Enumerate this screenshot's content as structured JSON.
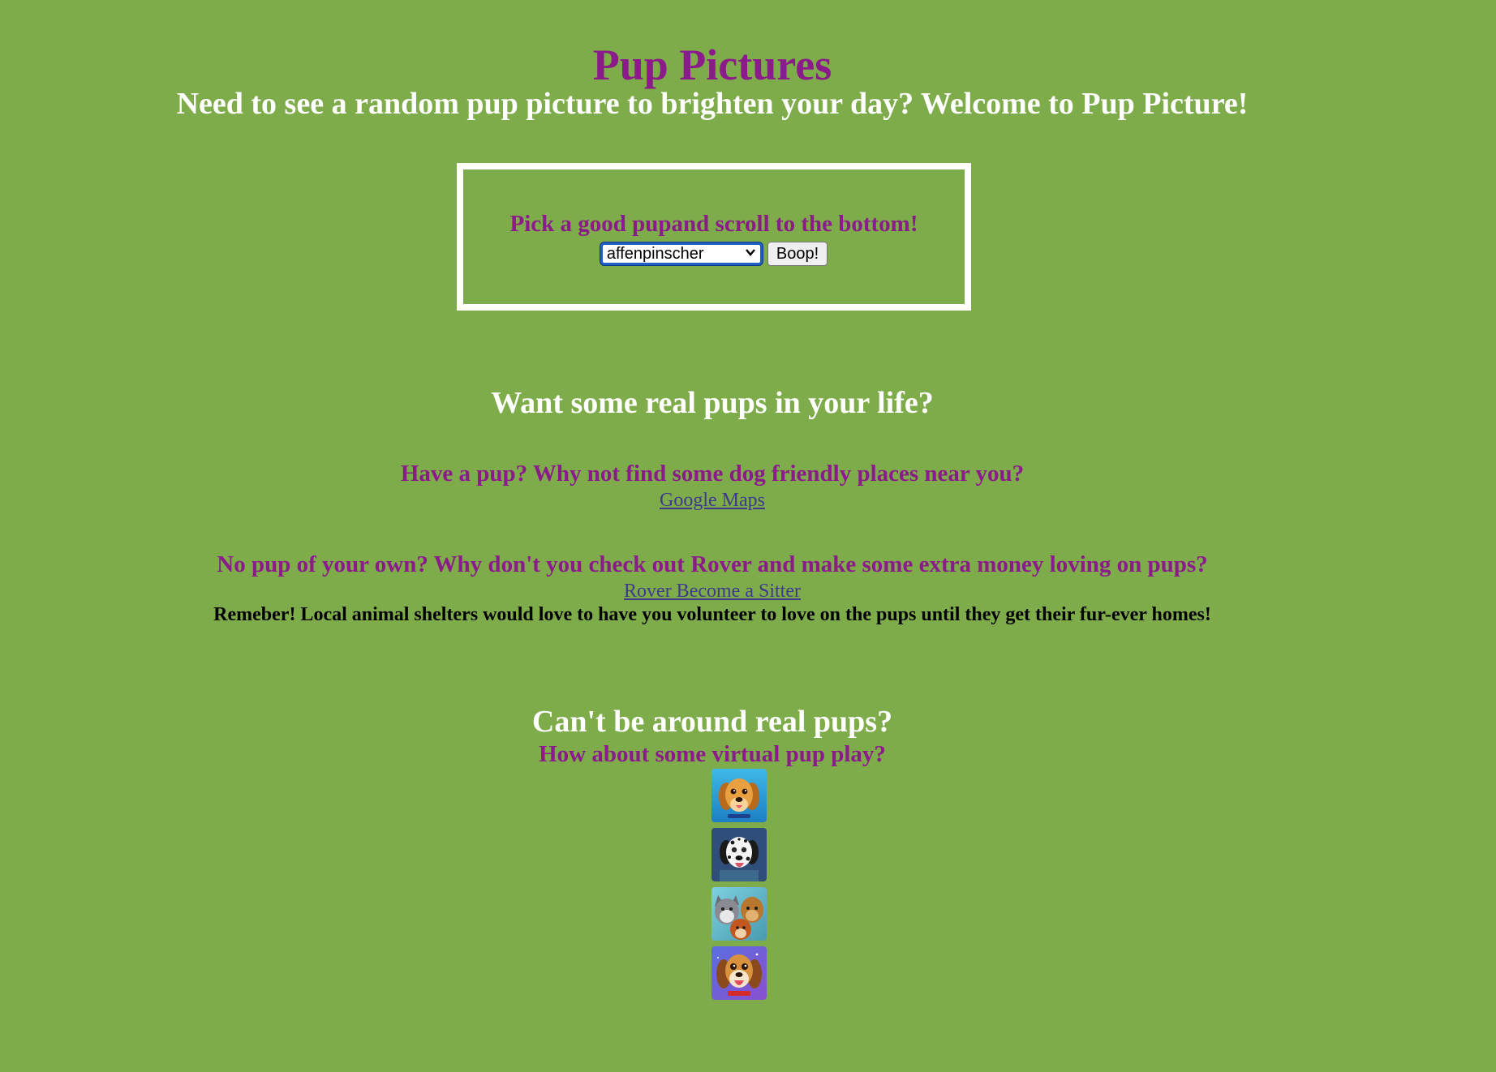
{
  "header": {
    "title": "Pup Pictures",
    "subtitle": "Need to see a random pup picture to brighten your day? Welcome to Pup Picture!"
  },
  "picker": {
    "prompt": "Pick a good pupand scroll to the bottom!",
    "selected_breed": "affenpinscher",
    "button_label": "Boop!"
  },
  "real_pups": {
    "heading": "Want some real pups in your life?",
    "have_pup_text": "Have a pup? Why not find some dog friendly places near you?",
    "maps_link": "Google Maps",
    "no_pup_text": "No pup of your own? Why don't you check out Rover and make some extra money loving on pups?",
    "rover_link": "Rover Become a Sitter",
    "reminder": "Remeber! Local animal shelters would love to have you volunteer to love on the pups until they get their fur-ever homes!"
  },
  "virtual_pups": {
    "heading": "Can't be around real pups?",
    "subheading": "How about some virtual pup play?",
    "games": [
      {
        "icon": "golden-retriever-game-icon"
      },
      {
        "icon": "dalmatian-game-icon"
      },
      {
        "icon": "dog-pack-game-icon"
      },
      {
        "icon": "beagle-puppy-game-icon"
      }
    ]
  },
  "colors": {
    "background": "#7fac4a",
    "accent_purple": "#8b1a8b",
    "link": "#3d3a8c"
  }
}
